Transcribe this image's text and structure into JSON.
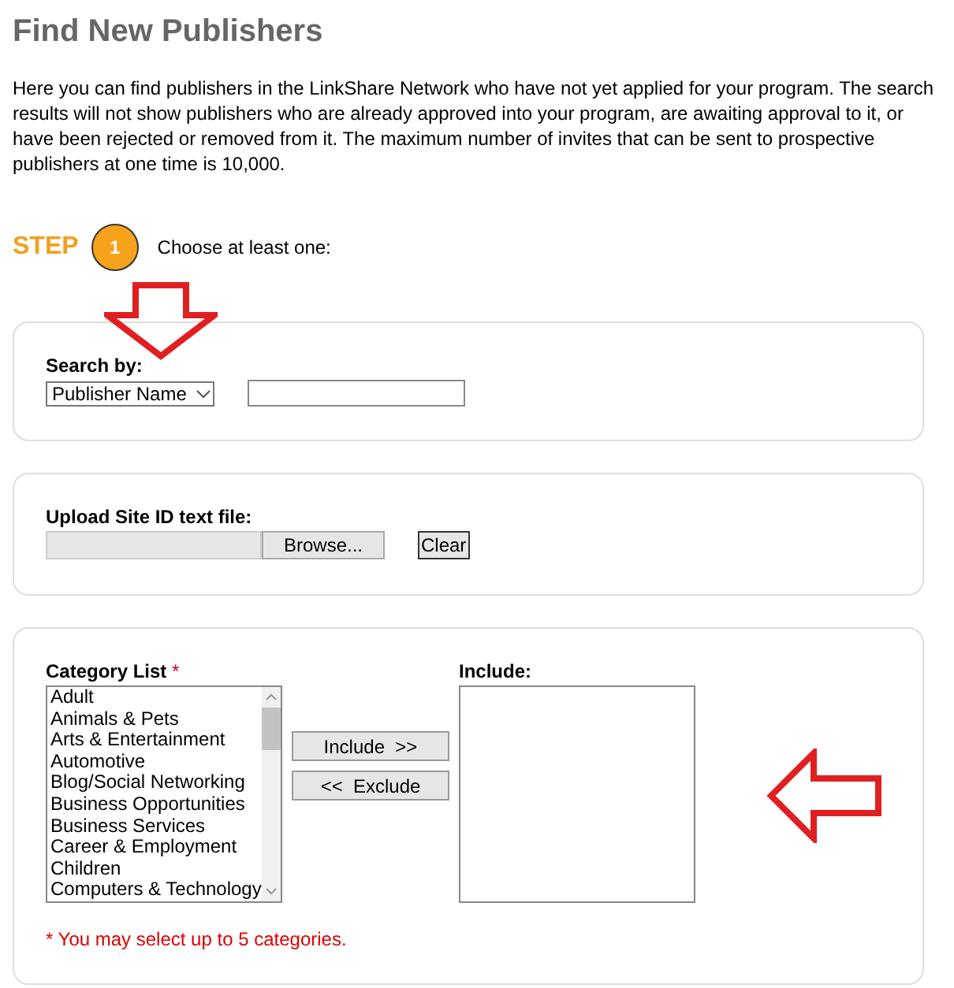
{
  "title": "Find New Publishers",
  "intro": "Here you can find publishers in the LinkShare Network who have not yet applied for your program. The search results will not show publishers who are already approved into your program, are awaiting approval to it, or have been rejected or removed from it. The maximum number of invites that can be sent to prospective publishers at one time is 10,000.",
  "step": {
    "label": "STEP",
    "number": "1",
    "instruction": "Choose at least one:"
  },
  "search": {
    "label": "Search by:",
    "select_value": "Publisher Name"
  },
  "upload": {
    "label": "Upload Site ID text file:",
    "browse_button": "Browse...",
    "clear_button": "Clear"
  },
  "categories": {
    "label": "Category List",
    "required_mark": "*",
    "items": [
      "Adult",
      "Animals & Pets",
      "Arts & Entertainment",
      "Automotive",
      "Blog/Social Networking",
      "Business Opportunities",
      "Business Services",
      "Career & Employment",
      "Children",
      "Computers & Technology"
    ],
    "include_button": "Include  >>",
    "exclude_button": "<<  Exclude",
    "include_label": "Include:",
    "note": "* You may select up to 5 categories."
  }
}
